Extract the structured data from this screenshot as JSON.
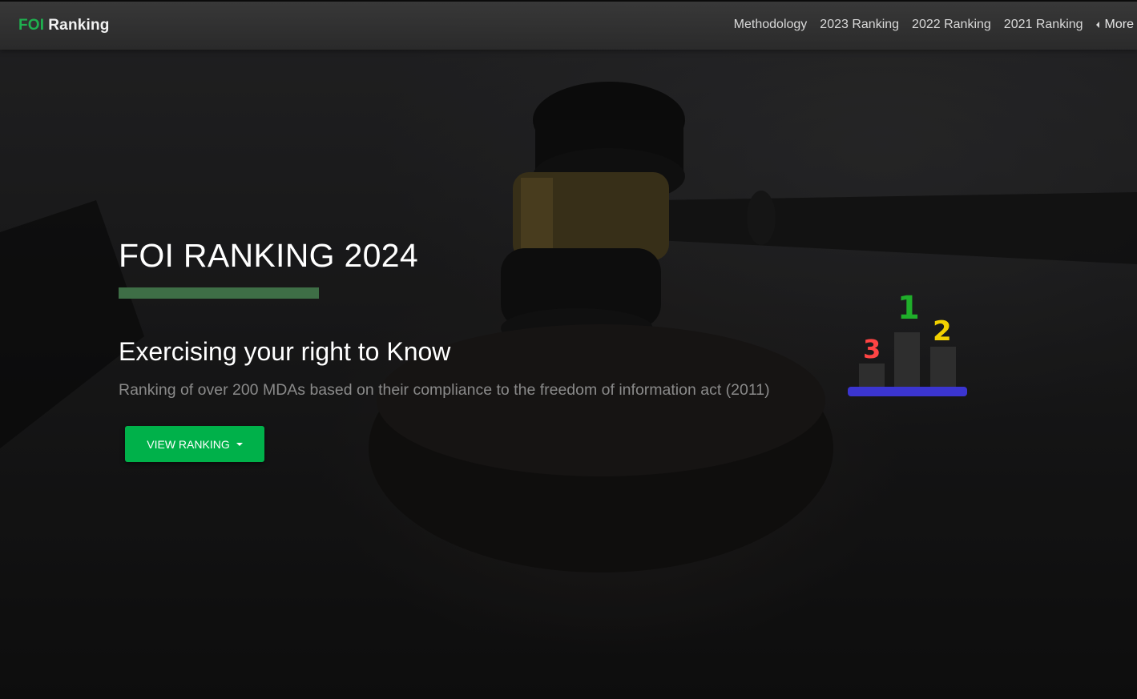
{
  "navbar": {
    "brand_prefix": "FOI",
    "brand_suffix": "Ranking",
    "links": [
      "Methodology",
      "2023 Ranking",
      "2022 Ranking",
      "2021 Ranking"
    ],
    "more_label": "More",
    "more_icon": "caret-left-icon"
  },
  "hero": {
    "title": "FOI RANKING 2024",
    "subtitle": "Exercising your right to Know",
    "description": "Ranking of over 200 MDAs based on their compliance to the freedom of information act (2011)",
    "cta_label": "VIEW RANKING",
    "cta_icon": "caret-down-icon"
  },
  "podium": {
    "first": "1",
    "second": "2",
    "third": "3"
  },
  "colors": {
    "brand_green": "#1fb04f",
    "button_green": "#00b14a",
    "title_underline": "#3e6e46",
    "podium_base": "#3b35d0",
    "podium_first": "#1fae2a",
    "podium_second": "#f2d100",
    "podium_third": "#ff4444"
  }
}
